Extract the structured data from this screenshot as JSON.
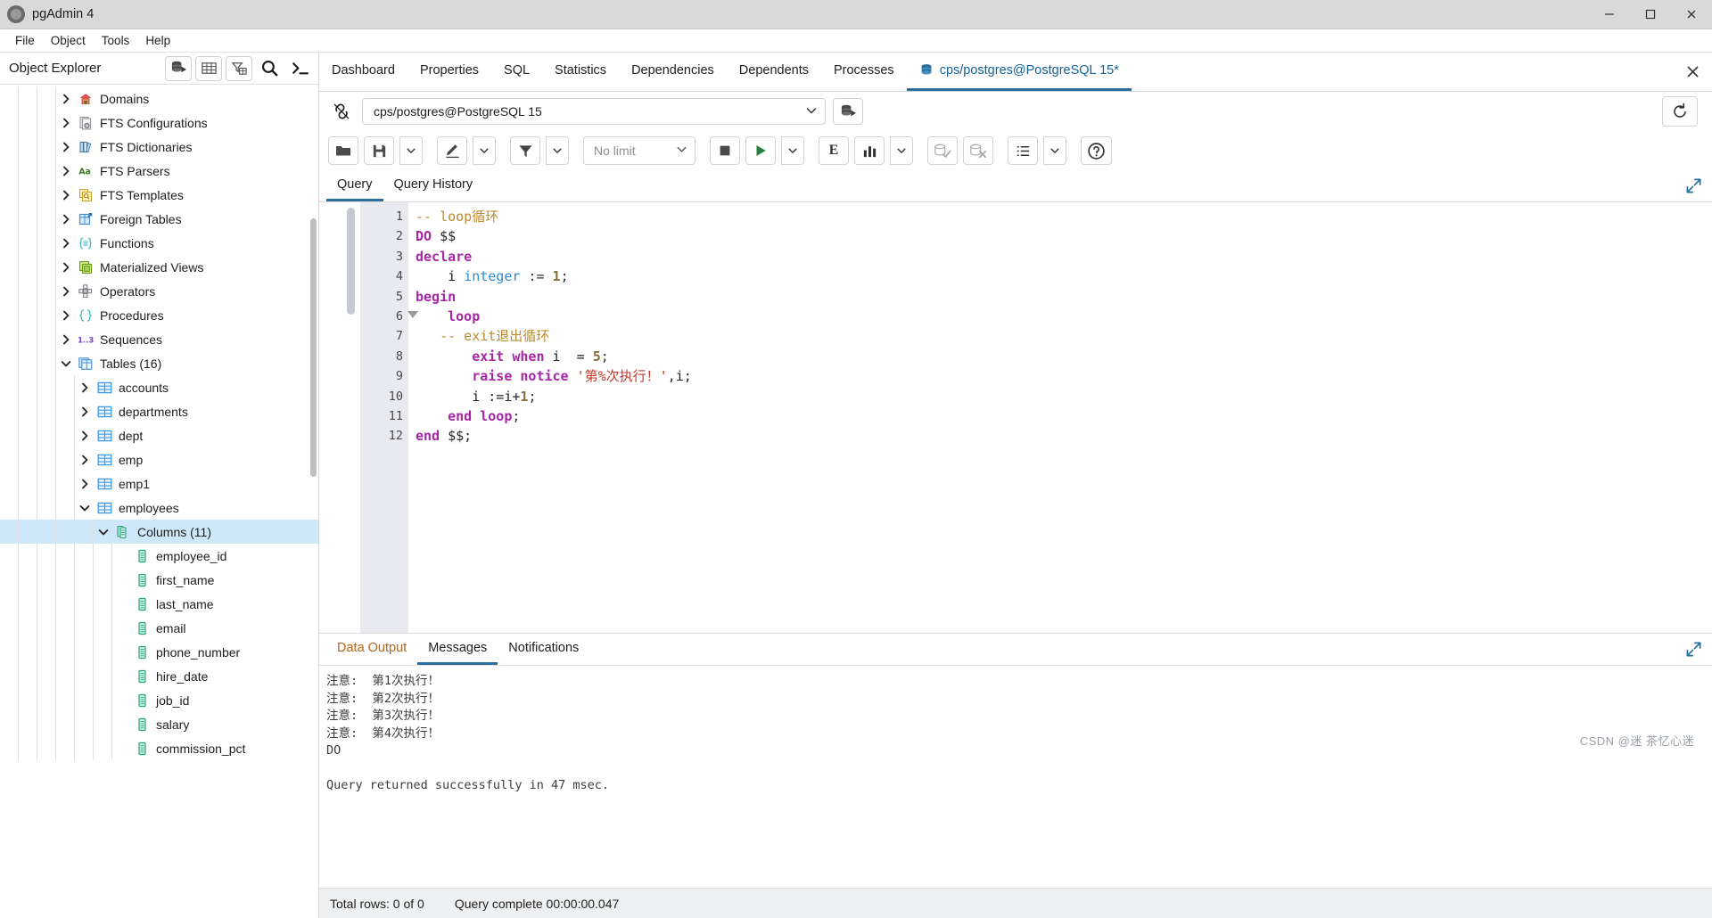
{
  "window": {
    "title": "pgAdmin 4",
    "app_icon": "pgadmin-logo-icon",
    "minimize_label": "Minimize",
    "maximize_label": "Maximize",
    "close_label": "Close"
  },
  "menubar": {
    "items": [
      "File",
      "Object",
      "Tools",
      "Help"
    ]
  },
  "object_explorer": {
    "title": "Object Explorer",
    "tools": [
      {
        "name": "add-server-icon",
        "label": "Add New Server"
      },
      {
        "name": "table-grid-icon",
        "label": "View Data"
      },
      {
        "name": "filter-table-icon",
        "label": "Filtered Rows"
      },
      {
        "name": "search-icon",
        "label": "Search Objects"
      },
      {
        "name": "terminal-icon",
        "label": "PSQL Tool"
      }
    ],
    "tree": [
      {
        "label": "Domains",
        "depth": 3,
        "state": "collapsed",
        "icon": "domain-icon"
      },
      {
        "label": "FTS Configurations",
        "depth": 3,
        "state": "collapsed",
        "icon": "fts-config-icon"
      },
      {
        "label": "FTS Dictionaries",
        "depth": 3,
        "state": "collapsed",
        "icon": "fts-dictionary-icon"
      },
      {
        "label": "FTS Parsers",
        "depth": 3,
        "state": "collapsed",
        "icon": "fts-parser-icon"
      },
      {
        "label": "FTS Templates",
        "depth": 3,
        "state": "collapsed",
        "icon": "fts-template-icon"
      },
      {
        "label": "Foreign Tables",
        "depth": 3,
        "state": "collapsed",
        "icon": "foreign-table-icon"
      },
      {
        "label": "Functions",
        "depth": 3,
        "state": "collapsed",
        "icon": "function-icon"
      },
      {
        "label": "Materialized Views",
        "depth": 3,
        "state": "collapsed",
        "icon": "matview-icon"
      },
      {
        "label": "Operators",
        "depth": 3,
        "state": "collapsed",
        "icon": "operator-icon"
      },
      {
        "label": "Procedures",
        "depth": 3,
        "state": "collapsed",
        "icon": "procedure-icon"
      },
      {
        "label": "Sequences",
        "depth": 3,
        "state": "collapsed",
        "icon": "sequence-icon"
      },
      {
        "label": "Tables (16)",
        "depth": 3,
        "state": "expanded",
        "icon": "tables-icon"
      },
      {
        "label": "accounts",
        "depth": 4,
        "state": "collapsed",
        "icon": "table-icon"
      },
      {
        "label": "departments",
        "depth": 4,
        "state": "collapsed",
        "icon": "table-icon"
      },
      {
        "label": "dept",
        "depth": 4,
        "state": "collapsed",
        "icon": "table-icon"
      },
      {
        "label": "emp",
        "depth": 4,
        "state": "collapsed",
        "icon": "table-icon"
      },
      {
        "label": "emp1",
        "depth": 4,
        "state": "collapsed",
        "icon": "table-icon"
      },
      {
        "label": "employees",
        "depth": 4,
        "state": "expanded",
        "icon": "table-icon"
      },
      {
        "label": "Columns (11)",
        "depth": 5,
        "state": "expanded",
        "icon": "columns-icon",
        "selected": true
      },
      {
        "label": "employee_id",
        "depth": 6,
        "state": "leaf",
        "icon": "column-icon"
      },
      {
        "label": "first_name",
        "depth": 6,
        "state": "leaf",
        "icon": "column-icon"
      },
      {
        "label": "last_name",
        "depth": 6,
        "state": "leaf",
        "icon": "column-icon"
      },
      {
        "label": "email",
        "depth": 6,
        "state": "leaf",
        "icon": "column-icon"
      },
      {
        "label": "phone_number",
        "depth": 6,
        "state": "leaf",
        "icon": "column-icon"
      },
      {
        "label": "hire_date",
        "depth": 6,
        "state": "leaf",
        "icon": "column-icon"
      },
      {
        "label": "job_id",
        "depth": 6,
        "state": "leaf",
        "icon": "column-icon"
      },
      {
        "label": "salary",
        "depth": 6,
        "state": "leaf",
        "icon": "column-icon"
      },
      {
        "label": "commission_pct",
        "depth": 6,
        "state": "leaf",
        "icon": "column-icon"
      }
    ]
  },
  "main_tabs": {
    "items": [
      {
        "label": "Dashboard",
        "active": false
      },
      {
        "label": "Properties",
        "active": false
      },
      {
        "label": "SQL",
        "active": false
      },
      {
        "label": "Statistics",
        "active": false
      },
      {
        "label": "Dependencies",
        "active": false
      },
      {
        "label": "Dependents",
        "active": false
      },
      {
        "label": "Processes",
        "active": false
      }
    ],
    "query_tab": {
      "label": "cps/postgres@PostgreSQL 15*",
      "active": true,
      "icon": "database-tab-icon"
    },
    "close_label": "×"
  },
  "connection_bar": {
    "link_icon": "connection-link-icon",
    "value": "cps/postgres@PostgreSQL 15",
    "dropdown_icon": "chevron-down-icon",
    "manage_icon": "manage-connections-icon",
    "reset_layout_icon": "reset-layout-icon"
  },
  "sql_toolbar": {
    "buttons": [
      {
        "name": "open-file-button",
        "icon": "folder-icon",
        "label": "Open File"
      },
      {
        "name": "save-file-button",
        "icon": "save-icon",
        "label": "Save File"
      },
      {
        "name": "save-dropdown-button",
        "icon": "chevron-down-icon",
        "label": "Save options"
      },
      {
        "name": "edit-button",
        "icon": "pencil-icon",
        "label": "Edit"
      },
      {
        "name": "edit-dropdown-button",
        "icon": "chevron-down-icon",
        "label": "Edit options"
      },
      {
        "name": "filter-button",
        "icon": "filter-icon",
        "label": "Filter"
      },
      {
        "name": "filter-dropdown-button",
        "icon": "chevron-down-icon",
        "label": "Filter options"
      },
      {
        "name": "stop-button",
        "icon": "stop-icon",
        "label": "Cancel query"
      },
      {
        "name": "execute-button",
        "icon": "play-icon",
        "label": "Execute script"
      },
      {
        "name": "execute-dropdown-button",
        "icon": "chevron-down-icon",
        "label": "Execute options"
      },
      {
        "name": "explain-button",
        "icon": "explain-e-icon",
        "label": "Explain"
      },
      {
        "name": "explain-analyze-button",
        "icon": "explain-analyze-icon",
        "label": "Explain Analyze"
      },
      {
        "name": "explain-dropdown-button",
        "icon": "chevron-down-icon",
        "label": "Explain options"
      },
      {
        "name": "commit-button",
        "icon": "commit-icon",
        "label": "Commit"
      },
      {
        "name": "rollback-button",
        "icon": "rollback-icon",
        "label": "Rollback"
      },
      {
        "name": "macros-button",
        "icon": "list-icon",
        "label": "Macros"
      },
      {
        "name": "macros-dropdown-button",
        "icon": "chevron-down-icon",
        "label": "Macros options"
      },
      {
        "name": "help-button",
        "icon": "help-icon",
        "label": "Help"
      }
    ],
    "row_limit": {
      "placeholder": "No limit",
      "value": "No limit"
    }
  },
  "query_tabs": {
    "items": [
      {
        "label": "Query",
        "active": true
      },
      {
        "label": "Query History",
        "active": false
      }
    ],
    "expand_icon": "expand-arrows-icon"
  },
  "editor": {
    "lines": [
      {
        "n": 1,
        "fold": false,
        "tokens": [
          {
            "t": "-- loop循环",
            "c": "cm"
          }
        ]
      },
      {
        "n": 2,
        "fold": false,
        "tokens": [
          {
            "t": "DO",
            "c": "k"
          },
          {
            "t": " $$",
            "c": "pl"
          }
        ]
      },
      {
        "n": 3,
        "fold": false,
        "tokens": [
          {
            "t": "declare",
            "c": "k"
          }
        ]
      },
      {
        "n": 4,
        "fold": false,
        "tokens": [
          {
            "t": "    i ",
            "c": "pl"
          },
          {
            "t": "integer",
            "c": "ty"
          },
          {
            "t": " := ",
            "c": "op"
          },
          {
            "t": "1",
            "c": "nu"
          },
          {
            "t": ";",
            "c": "op"
          }
        ]
      },
      {
        "n": 5,
        "fold": false,
        "tokens": [
          {
            "t": "begin",
            "c": "k"
          }
        ]
      },
      {
        "n": 6,
        "fold": true,
        "tokens": [
          {
            "t": "    ",
            "c": "pl"
          },
          {
            "t": "loop",
            "c": "k"
          }
        ]
      },
      {
        "n": 7,
        "fold": false,
        "tokens": [
          {
            "t": "   -- exit退出循环",
            "c": "cm"
          }
        ]
      },
      {
        "n": 8,
        "fold": false,
        "tokens": [
          {
            "t": "       ",
            "c": "pl"
          },
          {
            "t": "exit when",
            "c": "k"
          },
          {
            "t": " i  = ",
            "c": "pl"
          },
          {
            "t": "5",
            "c": "nu"
          },
          {
            "t": ";",
            "c": "op"
          }
        ]
      },
      {
        "n": 9,
        "fold": false,
        "tokens": [
          {
            "t": "       ",
            "c": "pl"
          },
          {
            "t": "raise notice",
            "c": "k"
          },
          {
            "t": " ",
            "c": "pl"
          },
          {
            "t": "'第%次执行！'",
            "c": "st"
          },
          {
            "t": ",i;",
            "c": "pl"
          }
        ]
      },
      {
        "n": 10,
        "fold": false,
        "tokens": [
          {
            "t": "       i :=i+",
            "c": "pl"
          },
          {
            "t": "1",
            "c": "nu"
          },
          {
            "t": ";",
            "c": "op"
          }
        ]
      },
      {
        "n": 11,
        "fold": false,
        "tokens": [
          {
            "t": "    ",
            "c": "pl"
          },
          {
            "t": "end loop",
            "c": "k"
          },
          {
            "t": ";",
            "c": "op"
          }
        ]
      },
      {
        "n": 12,
        "fold": false,
        "tokens": [
          {
            "t": "end",
            "c": "k"
          },
          {
            "t": " $$;",
            "c": "pl"
          }
        ]
      }
    ]
  },
  "results": {
    "tabs": [
      {
        "label": "Data Output",
        "active": false
      },
      {
        "label": "Messages",
        "active": true
      },
      {
        "label": "Notifications",
        "active": false
      }
    ],
    "expand_icon": "expand-arrows-icon",
    "messages": "注意:  第1次执行！\n注意:  第2次执行！\n注意:  第3次执行！\n注意:  第4次执行！\nDO\n\nQuery returned successfully in 47 msec."
  },
  "statusbar": {
    "total_rows": "Total rows: 0 of 0",
    "query_complete": "Query complete 00:00:00.047",
    "watermark": "CSDN @迷 茶忆心迷"
  },
  "colors": {
    "accent": "#2a6f9e",
    "active_tab_text": "#11619a",
    "selection": "#cfe8f9",
    "gutter_bg": "#e8eaf0",
    "keyword": "#a626a4",
    "comment": "#b98b2e",
    "type": "#2a8ad4",
    "string": "#c0392b",
    "number": "#8a6d3b",
    "table_icon": "#3f9ae5",
    "column_icon": "#22a07c"
  }
}
